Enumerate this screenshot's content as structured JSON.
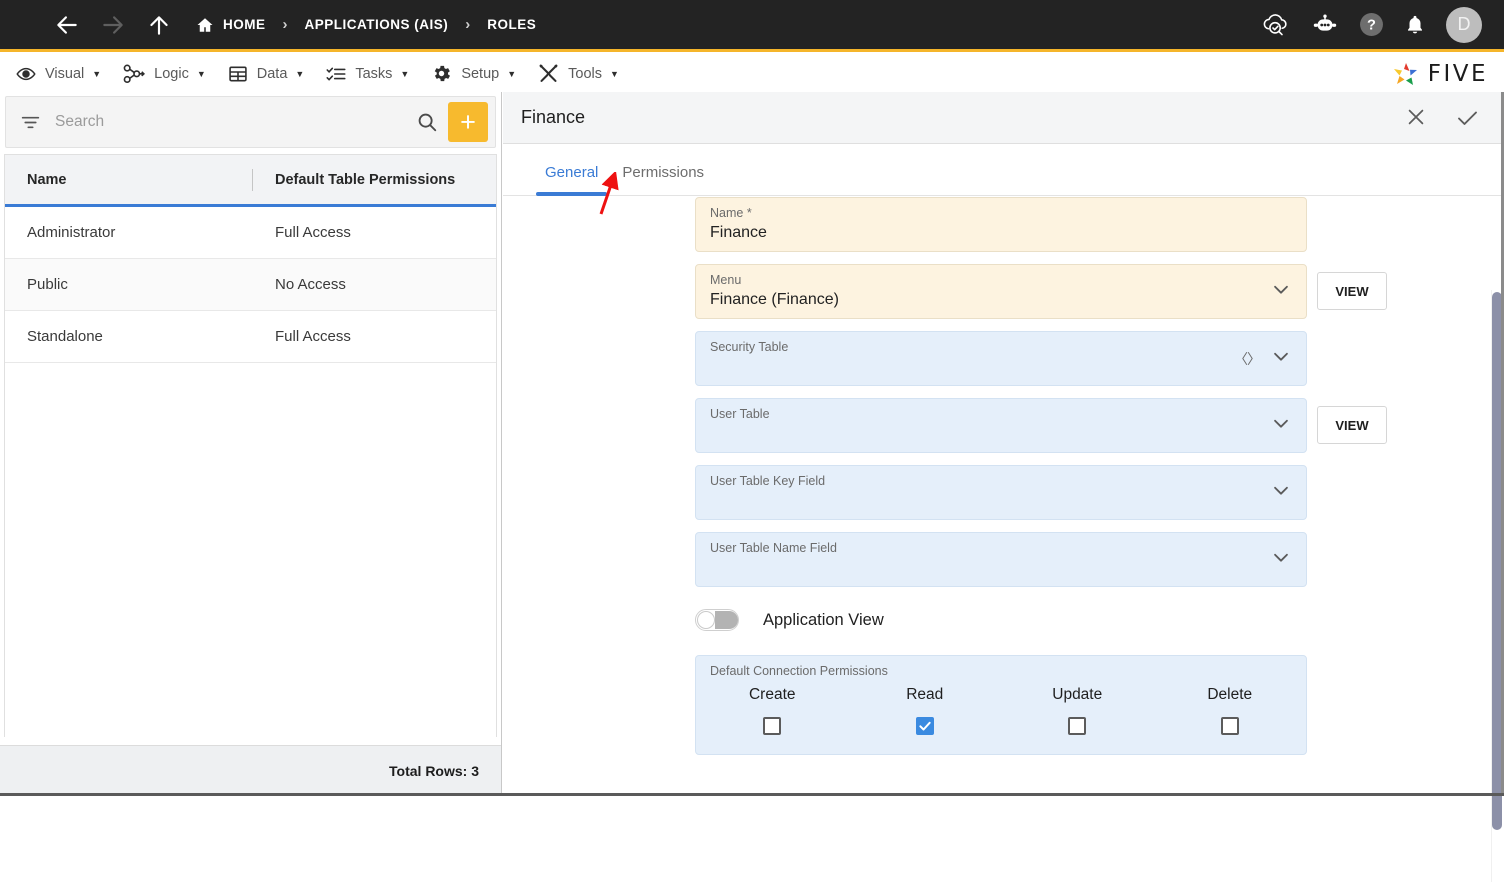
{
  "topbar": {
    "menu_icon": "hamburger-icon",
    "back_icon": "arrow-left-icon",
    "forward_icon": "arrow-right-icon",
    "up_icon": "arrow-up-icon",
    "breadcrumbs": [
      {
        "label": "HOME",
        "icon": "home-icon"
      },
      {
        "label": "APPLICATIONS (AIS)",
        "icon": ""
      },
      {
        "label": "ROLES",
        "icon": ""
      }
    ],
    "separator": "›",
    "right_icons": [
      {
        "name": "cloud-check-icon"
      },
      {
        "name": "chatbot-icon"
      },
      {
        "name": "help-icon"
      },
      {
        "name": "notifications-bell-icon"
      }
    ],
    "avatar_initial": "D",
    "accent_color": "#f5b52a",
    "background_color": "#232323"
  },
  "menubar": {
    "items": [
      {
        "label": "Visual",
        "icon": "eye-icon",
        "caret": "▼"
      },
      {
        "label": "Logic",
        "icon": "logic-nodes-icon",
        "caret": "▼"
      },
      {
        "label": "Data",
        "icon": "table-grid-icon",
        "caret": "▼"
      },
      {
        "label": "Tasks",
        "icon": "checklist-icon",
        "caret": "▼"
      },
      {
        "label": "Setup",
        "icon": "gear-icon",
        "caret": "▼"
      },
      {
        "label": "Tools",
        "icon": "tools-wrench-icon",
        "caret": "▼"
      }
    ],
    "brand": "FIVE"
  },
  "sidebar": {
    "search": {
      "placeholder": "Search",
      "value": "",
      "filter_icon": "filter-icon",
      "search_icon": "search-icon"
    },
    "add_button_label": "+",
    "grid": {
      "columns": [
        "Name",
        "Default Table Permissions"
      ],
      "rows": [
        {
          "name": "Administrator",
          "permissions": "Full Access"
        },
        {
          "name": "Public",
          "permissions": "No Access"
        },
        {
          "name": "Standalone",
          "permissions": "Full Access"
        }
      ]
    },
    "footer": {
      "total_rows": "Total Rows: 3"
    },
    "header_underline_color": "#3a7bd5"
  },
  "detail": {
    "title": "Finance",
    "close_label": "✕",
    "confirm_label": "✓",
    "tabs": [
      {
        "label": "General",
        "active": true
      },
      {
        "label": "Permissions",
        "active": false
      }
    ],
    "fields": [
      {
        "label": "Name *",
        "value": "Finance",
        "state": "filled",
        "has_chevron": false,
        "has_code_icon": false,
        "view_button": ""
      },
      {
        "label": "Menu",
        "value": "Finance (Finance)",
        "state": "filled",
        "has_chevron": true,
        "has_code_icon": false,
        "view_button": "VIEW"
      },
      {
        "label": "Security Table",
        "value": "",
        "state": "empty",
        "has_chevron": true,
        "has_code_icon": true,
        "view_button": ""
      },
      {
        "label": "User Table",
        "value": "",
        "state": "empty",
        "has_chevron": true,
        "has_code_icon": false,
        "view_button": "VIEW"
      },
      {
        "label": "User Table Key Field",
        "value": "",
        "state": "empty",
        "has_chevron": true,
        "has_code_icon": false,
        "view_button": ""
      },
      {
        "label": "User Table Name Field",
        "value": "",
        "state": "empty",
        "has_chevron": true,
        "has_code_icon": false,
        "view_button": ""
      }
    ],
    "application_view": {
      "label": "Application View",
      "enabled": false
    },
    "connection_permissions": {
      "label": "Default Connection Permissions",
      "items": [
        {
          "name": "Create",
          "checked": false
        },
        {
          "name": "Read",
          "checked": true
        },
        {
          "name": "Update",
          "checked": false
        },
        {
          "name": "Delete",
          "checked": false
        }
      ],
      "checked_color": "#3a8ae0"
    },
    "annotation": {
      "type": "red-arrow",
      "points_to": "Permissions",
      "color": "#ee1111"
    }
  }
}
